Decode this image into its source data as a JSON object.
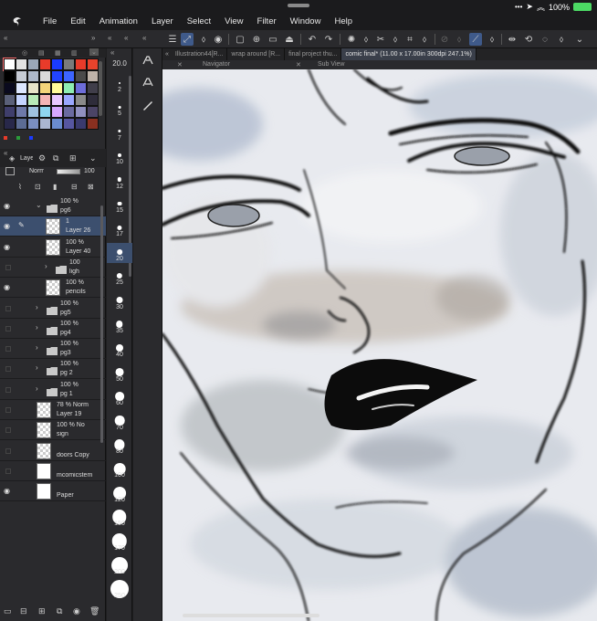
{
  "statusbar": {
    "battery": "100%"
  },
  "menu": {
    "items": [
      "File",
      "Edit",
      "Animation",
      "Layer",
      "Select",
      "View",
      "Filter",
      "Window",
      "Help"
    ]
  },
  "toolbar": {
    "icons": [
      "hamburger-icon",
      "transform-icon",
      "lock-icon",
      "record-icon",
      "new-canvas-icon",
      "add-image-icon",
      "open-folder-icon",
      "save-icon",
      "undo-icon",
      "redo-icon",
      "loading-icon",
      "cut-icon",
      "copy-icon",
      "crop-icon",
      "grid-icon",
      "ruler-icon",
      "flip-icon",
      "rotate-icon",
      "lasso-icon",
      "options-icon",
      "dropdown-icon"
    ]
  },
  "color_palette": {
    "swatches": [
      "#ffffff",
      "#e2e2e2",
      "#9aa7b8",
      "#e83b2a",
      "#1a3bff",
      "#7a7a7a",
      "#e83b2a",
      "#e8432c",
      "#000000",
      "#c6cbd4",
      "#aeb8c9",
      "#d9d9d9",
      "#2244ff",
      "#3d65ff",
      "#4a4a4a",
      "#bfb3a9",
      "#0a0a1e",
      "#dde7ff",
      "#e8e4c8",
      "#f4d57a",
      "#fffb9a",
      "#8eeeb2",
      "#6d6dd9",
      "#403e4a",
      "#5a6078",
      "#c5d5ff",
      "#b8ecb8",
      "#f5b5b5",
      "#e8c8ff",
      "#9aa7ff",
      "#8a8a8a",
      "#2e2c3a",
      "#3f3e6b",
      "#6e79a8",
      "#9fc2e0",
      "#8fd6f0",
      "#d6a8ff",
      "#6a6aa0",
      "#9090c0",
      "#4b4466",
      "#28284a",
      "#5c6c94",
      "#7a8ebf",
      "#aab6d0",
      "#6a8ccf",
      "#5656a0",
      "#3a3a6e",
      "#8a3020"
    ]
  },
  "layer_panel": {
    "tab_label": "Layer",
    "blend_mode": "Normal",
    "opacity_value": "100",
    "layers": [
      {
        "name": "pg6",
        "opacity": "100 %",
        "type": "folder",
        "visible": true,
        "expanded": true
      },
      {
        "name": "Layer 26",
        "opacity": "1",
        "type": "layer",
        "visible": true,
        "selected": true
      },
      {
        "name": "Layer 40",
        "opacity": "100 %",
        "type": "layer",
        "visible": true
      },
      {
        "name": "ligh",
        "opacity": "100",
        "type": "folder",
        "visible": false
      },
      {
        "name": "pencils",
        "opacity": "100 %",
        "type": "layer",
        "visible": true
      },
      {
        "name": "pg5",
        "opacity": "100 %",
        "type": "folder",
        "visible": false
      },
      {
        "name": "pg4",
        "opacity": "100 %",
        "type": "folder",
        "visible": false
      },
      {
        "name": "pg3",
        "opacity": "100 %",
        "type": "folder",
        "visible": false
      },
      {
        "name": "pg 2",
        "opacity": "100 %",
        "type": "folder",
        "visible": false
      },
      {
        "name": "pg 1",
        "opacity": "100 %",
        "type": "folder",
        "visible": false
      },
      {
        "name": "Layer 19",
        "opacity": "78 % Norm",
        "type": "layer",
        "visible": false
      },
      {
        "name": "sign",
        "opacity": "100 % No",
        "type": "layer",
        "visible": false
      },
      {
        "name": "doors Copy",
        "opacity": "",
        "type": "layer",
        "visible": false
      },
      {
        "name": "mcomicstem",
        "opacity": "",
        "type": "layer",
        "visible": false
      },
      {
        "name": "Paper",
        "opacity": "",
        "type": "layer",
        "visible": true
      }
    ]
  },
  "brush_size": {
    "current": "20.0",
    "sizes": [
      "2",
      "5",
      "7",
      "10",
      "12",
      "15",
      "17",
      "20",
      "25",
      "30",
      "35",
      "40",
      "50",
      "60",
      "70",
      "80",
      "100",
      "120",
      "150",
      "170",
      "200",
      "250"
    ],
    "selected": "20"
  },
  "tools": [
    "pen-tool-icon",
    "pen-pressure-icon",
    "pencil-icon"
  ],
  "doc_tabs": [
    {
      "label": "Illustration44[R..."
    },
    {
      "label": "wrap around [R..."
    },
    {
      "label": "final project thu..."
    },
    {
      "label": "comic final* (11.00 x 17.00in 300dpi 247.1%)",
      "active": true
    }
  ],
  "sub_tabs": {
    "navigator": "Navigator",
    "sub_view": "Sub View"
  }
}
